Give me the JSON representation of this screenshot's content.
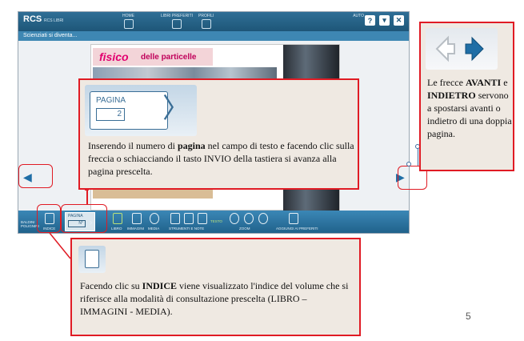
{
  "app": {
    "brand": "RCS",
    "brand_sub": "RCS LIBRI",
    "book_title": "Scienziati si diventa...",
    "nav": [
      "HOME",
      "LIBRI PREFERITI",
      "PROFILI"
    ],
    "auto_label": "AUTO",
    "top_icons": {
      "help": "?",
      "download": "▾",
      "close": "✕"
    },
    "page": {
      "title_word": "fisico",
      "title_rest": "delle particelle"
    },
    "toolbar": {
      "left_label": "BALDINI POLIGNINI",
      "indice": "INDICE",
      "pagina_label": "PAGINA",
      "pagina_value": "N°",
      "libro": "LIBRO",
      "immagini": "IMMAGINI",
      "media": "MEDIA",
      "strumenti": "STRUMENTI E NOTE",
      "testo": "TESTO",
      "zoom": "ZOOM",
      "aggiungi": "AGGIUNGI AI PREFERITI"
    }
  },
  "callout_pagina": {
    "img_label": "PAGINA",
    "img_value": "2",
    "text_1": "Inserendo il numero di ",
    "text_bold": "pagina",
    "text_2": " nel campo di testo e facendo clic sulla freccia o schiacciando il tasto INVIO della tastiera si avanza alla pagina prescelta."
  },
  "callout_frecce": {
    "text_1": "Le frecce ",
    "bold_1": "AVANTI",
    "text_2": " e ",
    "bold_2": "INDIETRO",
    "text_3": " servono a spostarsi avanti o indietro di una doppia pagina."
  },
  "callout_indice": {
    "text_1": "Facendo clic su ",
    "text_bold": "INDICE",
    "text_2": " viene visualizzato l'indice del volume che si riferisce alla modalità di consultazione prescelta (LIBRO – IMMAGINI - MEDIA)."
  },
  "slide_number": "5"
}
